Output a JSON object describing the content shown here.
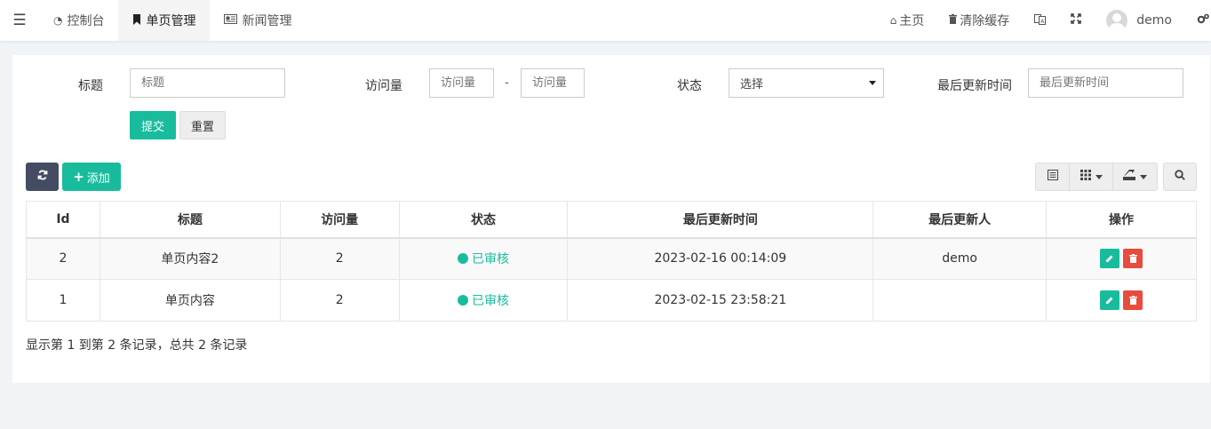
{
  "nav": {
    "menu_icon": "hamburger-menu-icon",
    "tabs": [
      {
        "label": "控制台",
        "icon": "dashboard-icon"
      },
      {
        "label": "单页管理",
        "icon": "bookmark-icon"
      },
      {
        "label": "新闻管理",
        "icon": "newspaper-icon"
      }
    ],
    "right": {
      "home_label": "主页",
      "clear_cache_label": "清除缓存",
      "username": "demo"
    }
  },
  "filters": {
    "title_label": "标题",
    "title_placeholder": "标题",
    "views_label": "访问量",
    "views_min_placeholder": "访问量",
    "views_max_placeholder": "访问量",
    "range_separator": "-",
    "status_label": "状态",
    "status_value": "选择",
    "updated_label": "最后更新时间",
    "updated_placeholder": "最后更新时间",
    "submit_label": "提交",
    "reset_label": "重置"
  },
  "toolbar": {
    "add_label": "添加"
  },
  "table": {
    "columns": [
      "Id",
      "标题",
      "访问量",
      "状态",
      "最后更新时间",
      "最后更新人",
      "操作"
    ],
    "rows": [
      {
        "id": "2",
        "title": "单页内容2",
        "views": "2",
        "status": "已审核",
        "updated": "2023-02-16 00:14:09",
        "updater": "demo"
      },
      {
        "id": "1",
        "title": "单页内容",
        "views": "2",
        "status": "已审核",
        "updated": "2023-02-15 23:58:21",
        "updater": ""
      }
    ]
  },
  "pagination": {
    "summary": "显示第 1 到第 2 条记录，总共 2 条记录"
  },
  "colors": {
    "primary": "#18bc9c",
    "danger": "#e74c3c",
    "dark": "#444c63"
  }
}
